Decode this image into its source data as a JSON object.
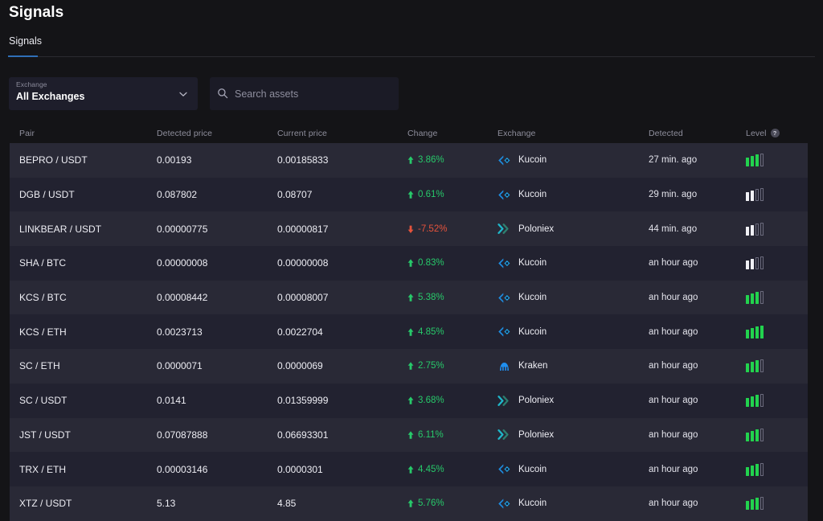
{
  "header": {
    "title": "Signals"
  },
  "tabs": [
    {
      "label": "Signals",
      "active": true
    }
  ],
  "filters": {
    "exchange_select": {
      "label": "Exchange",
      "value": "All Exchanges",
      "chevron_icon": "chevron-down-icon"
    },
    "search": {
      "placeholder": "Search assets",
      "value": "",
      "icon": "search-icon"
    }
  },
  "colors": {
    "page_background": "#141417",
    "row_odd": "#292936",
    "row_even": "#222230",
    "accent_blue": "#2f6fb8",
    "up_green": "#27c96a",
    "down_red": "#e5533c",
    "level_green": "#22d34e",
    "level_white": "#f0f0f5",
    "level_dim": "#6b6b7d"
  },
  "table": {
    "columns": [
      "Pair",
      "Detected price",
      "Current price",
      "Change",
      "Exchange",
      "Detected",
      "Level"
    ],
    "level_help_icon": "?",
    "rows": [
      {
        "pair": "BEPRO / USDT",
        "detected_price": "0.00193",
        "current_price": "0.00185833",
        "change": "3.86%",
        "direction": "up",
        "exchange": "Kucoin",
        "exchange_icon": "kucoin-icon",
        "detected": "27 min. ago",
        "level_bars": [
          "green",
          "green",
          "green",
          "dim"
        ]
      },
      {
        "pair": "DGB / USDT",
        "detected_price": "0.087802",
        "current_price": "0.08707",
        "change": "0.61%",
        "direction": "up",
        "exchange": "Kucoin",
        "exchange_icon": "kucoin-icon",
        "detected": "29 min. ago",
        "level_bars": [
          "white",
          "white",
          "dim",
          "dim"
        ]
      },
      {
        "pair": "LINKBEAR / USDT",
        "detected_price": "0.00000775",
        "current_price": "0.00000817",
        "change": "-7.52%",
        "direction": "down",
        "exchange": "Poloniex",
        "exchange_icon": "poloniex-icon",
        "detected": "44 min. ago",
        "level_bars": [
          "white",
          "white",
          "dim",
          "dim"
        ]
      },
      {
        "pair": "SHA / BTC",
        "detected_price": "0.00000008",
        "current_price": "0.00000008",
        "change": "0.83%",
        "direction": "up",
        "exchange": "Kucoin",
        "exchange_icon": "kucoin-icon",
        "detected": "an hour ago",
        "level_bars": [
          "white",
          "white",
          "dim",
          "dim"
        ]
      },
      {
        "pair": "KCS / BTC",
        "detected_price": "0.00008442",
        "current_price": "0.00008007",
        "change": "5.38%",
        "direction": "up",
        "exchange": "Kucoin",
        "exchange_icon": "kucoin-icon",
        "detected": "an hour ago",
        "level_bars": [
          "green",
          "green",
          "green",
          "dim"
        ]
      },
      {
        "pair": "KCS / ETH",
        "detected_price": "0.0023713",
        "current_price": "0.0022704",
        "change": "4.85%",
        "direction": "up",
        "exchange": "Kucoin",
        "exchange_icon": "kucoin-icon",
        "detected": "an hour ago",
        "level_bars": [
          "green",
          "green",
          "green",
          "green"
        ]
      },
      {
        "pair": "SC / ETH",
        "detected_price": "0.0000071",
        "current_price": "0.0000069",
        "change": "2.75%",
        "direction": "up",
        "exchange": "Kraken",
        "exchange_icon": "kraken-icon",
        "detected": "an hour ago",
        "level_bars": [
          "green",
          "green",
          "green",
          "dim"
        ]
      },
      {
        "pair": "SC / USDT",
        "detected_price": "0.0141",
        "current_price": "0.01359999",
        "change": "3.68%",
        "direction": "up",
        "exchange": "Poloniex",
        "exchange_icon": "poloniex-icon",
        "detected": "an hour ago",
        "level_bars": [
          "green",
          "green",
          "green",
          "dim"
        ]
      },
      {
        "pair": "JST / USDT",
        "detected_price": "0.07087888",
        "current_price": "0.06693301",
        "change": "6.11%",
        "direction": "up",
        "exchange": "Poloniex",
        "exchange_icon": "poloniex-icon",
        "detected": "an hour ago",
        "level_bars": [
          "green",
          "green",
          "green",
          "dim"
        ]
      },
      {
        "pair": "TRX / ETH",
        "detected_price": "0.00003146",
        "current_price": "0.0000301",
        "change": "4.45%",
        "direction": "up",
        "exchange": "Kucoin",
        "exchange_icon": "kucoin-icon",
        "detected": "an hour ago",
        "level_bars": [
          "green",
          "green",
          "green",
          "dim"
        ]
      },
      {
        "pair": "XTZ / USDT",
        "detected_price": "5.13",
        "current_price": "4.85",
        "change": "5.76%",
        "direction": "up",
        "exchange": "Kucoin",
        "exchange_icon": "kucoin-icon",
        "detected": "an hour ago",
        "level_bars": [
          "green",
          "green",
          "green",
          "dim"
        ]
      }
    ]
  }
}
